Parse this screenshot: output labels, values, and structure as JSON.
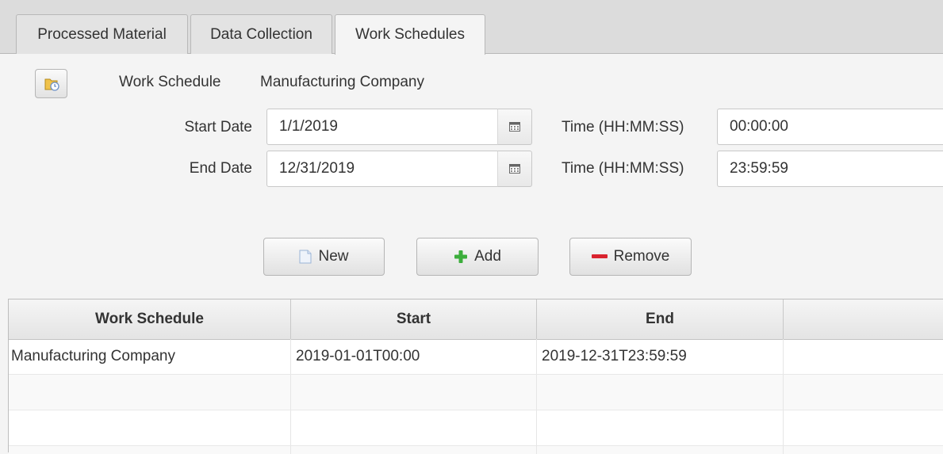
{
  "tabs": [
    {
      "label": "Processed Material"
    },
    {
      "label": "Data Collection"
    },
    {
      "label": "Work Schedules"
    }
  ],
  "form": {
    "work_schedule_label": "Work Schedule",
    "work_schedule_value": "Manufacturing Company",
    "start_date_label": "Start Date",
    "start_date_value": "1/1/2019",
    "start_time_label": "Time (HH:MM:SS)",
    "start_time_value": "00:00:00",
    "end_date_label": "End Date",
    "end_date_value": "12/31/2019",
    "end_time_label": "Time (HH:MM:SS)",
    "end_time_value": "23:59:59"
  },
  "buttons": {
    "new_label": "New",
    "add_label": "Add",
    "remove_label": "Remove"
  },
  "table": {
    "columns": [
      "Work Schedule",
      "Start",
      "End",
      ""
    ],
    "rows": [
      [
        "Manufacturing Company",
        "2019-01-01T00:00",
        "2019-12-31T23:59:59",
        ""
      ]
    ]
  },
  "colors": {
    "add_green": "#3cae3c",
    "remove_red": "#d9232e"
  }
}
